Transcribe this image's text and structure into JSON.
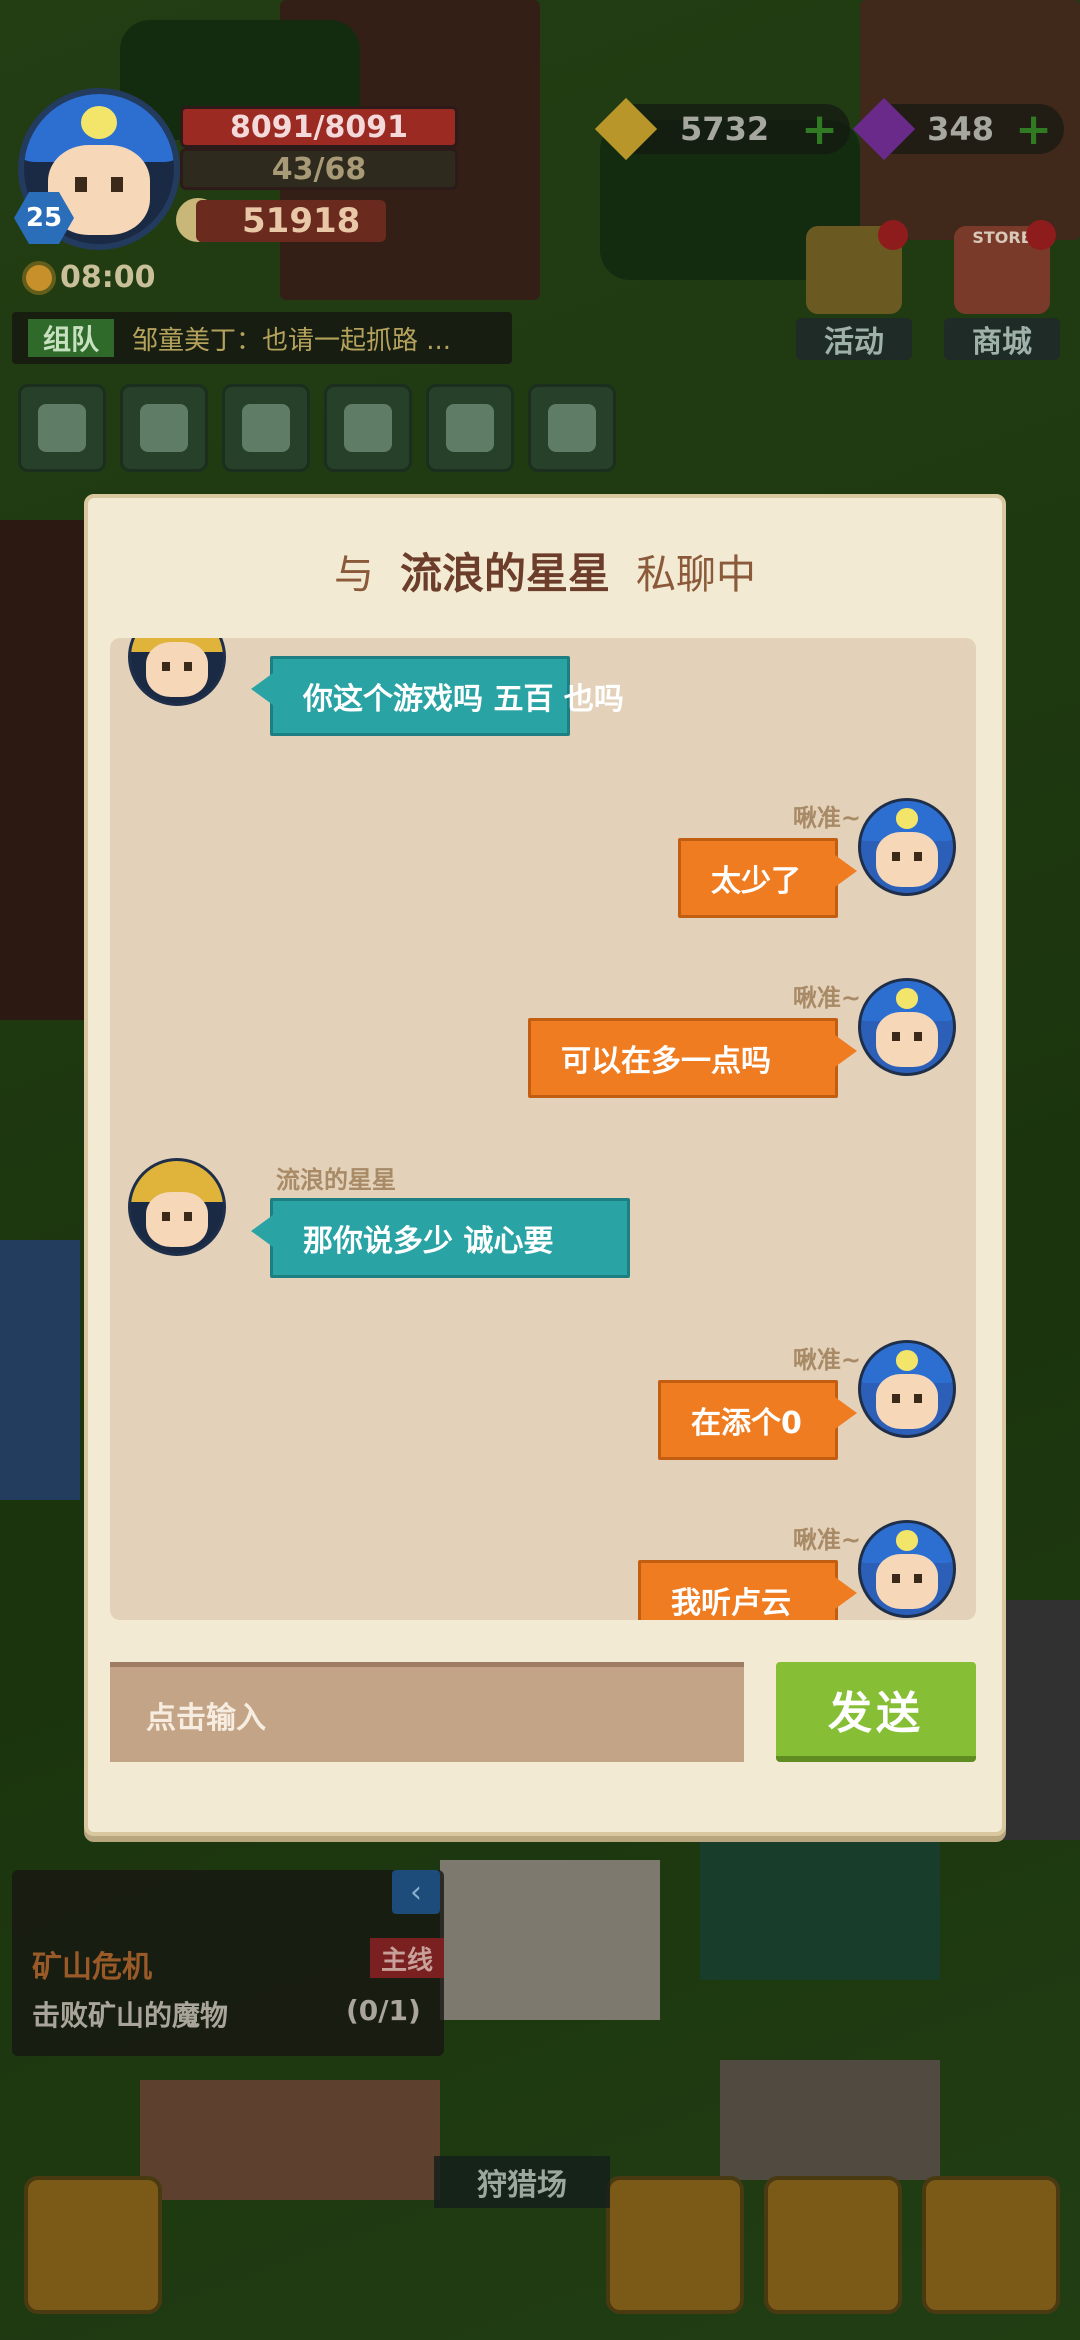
{
  "hud": {
    "level": "25",
    "hp": "8091/8091",
    "energy": "43/68",
    "coins": "51918",
    "time": "08:00",
    "team_tag": "组队",
    "team_message": "邹童美丁：也请一起抓路 ...",
    "gold_amount": "5732",
    "gem_amount": "348",
    "events_label": "活动",
    "store_label": "商城",
    "store_sign": "STORE"
  },
  "quest": {
    "title": "矿山危机",
    "tag": "主线",
    "description": "击败矿山的魔物",
    "progress": "(0/1)"
  },
  "bottom": {
    "hunt_label": "狩猎场"
  },
  "chat": {
    "title_prefix": "与",
    "partner_name": "流浪的星星",
    "title_suffix": "私聊中",
    "messages": [
      {
        "side": "left",
        "sender": "",
        "text": "你这个游戏吗 五百 也吗"
      },
      {
        "side": "right",
        "sender": "啾准~",
        "text": "太少了"
      },
      {
        "side": "right",
        "sender": "啾准~",
        "text": "可以在多一点吗"
      },
      {
        "side": "left",
        "sender": "流浪的星星",
        "text": "那你说多少 诚心要"
      },
      {
        "side": "right",
        "sender": "啾准~",
        "text": "在添个0"
      },
      {
        "side": "right",
        "sender": "啾准~",
        "text": "我听卢云"
      }
    ],
    "input_placeholder": "点击输入",
    "send_label": "发送"
  },
  "colors": {
    "dialog_bg": "#f3ead3",
    "left_bubble": "#2aa3a5",
    "right_bubble": "#f07c21",
    "send_button": "#86bf35"
  }
}
